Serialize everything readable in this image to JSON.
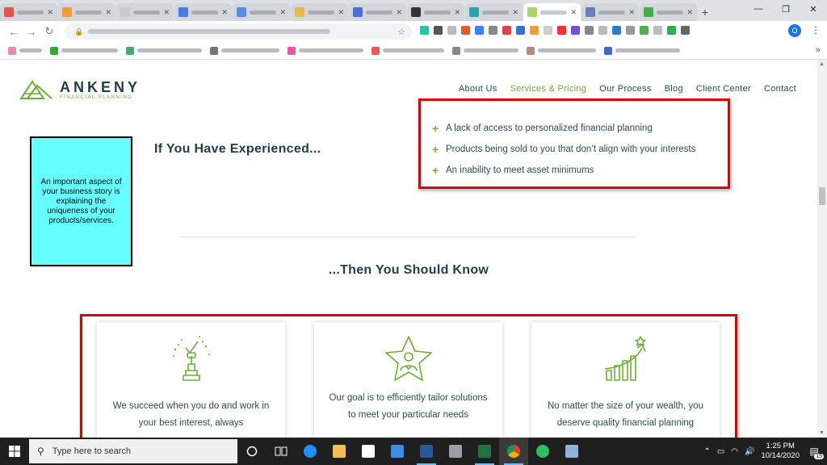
{
  "browser": {
    "tabs_count": 13,
    "active_tab_index": 9,
    "extensions_count": 20,
    "profile_initial": "O"
  },
  "site": {
    "logo_main": "ANKENY",
    "logo_sub": "FINANCIAL PLANNING",
    "nav": [
      {
        "label": "About Us",
        "active": false
      },
      {
        "label": "Services & Pricing",
        "active": true
      },
      {
        "label": "Our Process",
        "active": false
      },
      {
        "label": "Blog",
        "active": false
      },
      {
        "label": "Client Center",
        "active": false
      },
      {
        "label": "Contact",
        "active": false
      }
    ],
    "annotation": "An important aspect of your business story is explaining the uniqueness of your products/services.",
    "experienced_heading": "If You Have Experienced...",
    "bullets": [
      "A lack of access to personalized financial planning",
      "Products being sold to you that don’t align with your interests",
      "An inability to meet asset minimums"
    ],
    "know_heading": "...Then You Should Know",
    "cards": [
      {
        "icon": "trophy-icon",
        "text": "We succeed when you do and work in your best interest, always"
      },
      {
        "icon": "star-person-icon",
        "text": "Our goal is to efficiently tailor solutions to meet your particular needs"
      },
      {
        "icon": "growth-chart-icon",
        "text": "No matter the size of your wealth, you deserve quality financial planning"
      }
    ],
    "accent_color": "#6db030",
    "heading_color": "#1f3f48",
    "highlight_color": "#e00000"
  },
  "taskbar": {
    "search_placeholder": "Type here to search",
    "time": "1:25 PM",
    "date": "10/14/2020",
    "notification_count": "15"
  }
}
